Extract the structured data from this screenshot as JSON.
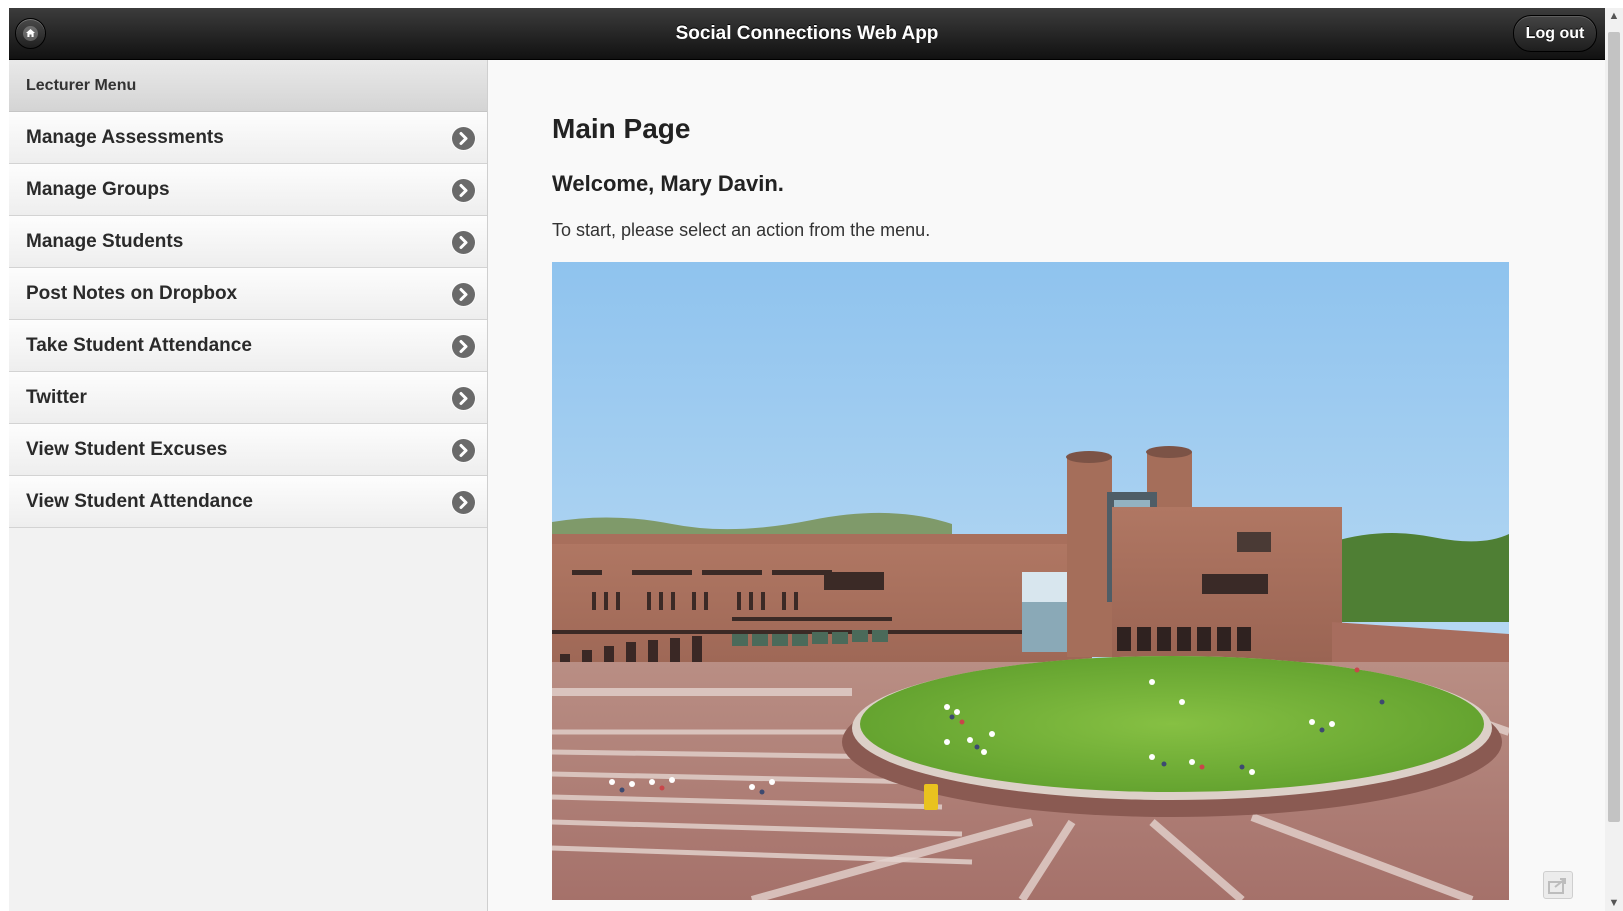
{
  "header": {
    "title": "Social Connections Web App",
    "logout_label": "Log out",
    "home_icon": "home-icon"
  },
  "sidebar": {
    "heading": "Lecturer Menu",
    "items": [
      {
        "label": "Manage Assessments"
      },
      {
        "label": "Manage Groups"
      },
      {
        "label": "Manage Students"
      },
      {
        "label": "Post Notes on Dropbox"
      },
      {
        "label": "Take Student Attendance"
      },
      {
        "label": "Twitter"
      },
      {
        "label": "View Student Excuses"
      },
      {
        "label": "View Student Attendance"
      }
    ],
    "item_icon": "chevron-right-circle-icon"
  },
  "main": {
    "page_title": "Main Page",
    "welcome": "Welcome, Mary Davin.",
    "instructions": "To start, please select an action from the menu."
  },
  "colors": {
    "header_bg": "#1e1e1e",
    "sidebar_bg": "#f2f2f2",
    "content_bg": "#f9f9f9",
    "text_dark": "#222222"
  }
}
